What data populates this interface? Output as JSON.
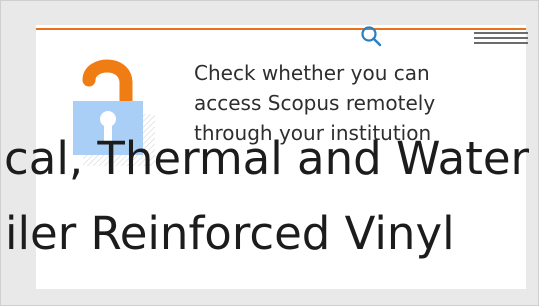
{
  "header": {
    "accent_color": "#e9711c",
    "search_icon": "search-icon",
    "menu_icon": "hamburger-menu-icon"
  },
  "promo": {
    "icon": "unlocked-padlock-icon",
    "lines": [
      "Check whether you can",
      "access Scopus remotely",
      "through your institution"
    ]
  },
  "article": {
    "title_lines": [
      "cal, Thermal and Water",
      "iler Reinforced Vinyl"
    ]
  },
  "colors": {
    "lock_body": "#aacff6",
    "lock_shackle": "#f07c14",
    "keyhole": "#ffffff"
  }
}
